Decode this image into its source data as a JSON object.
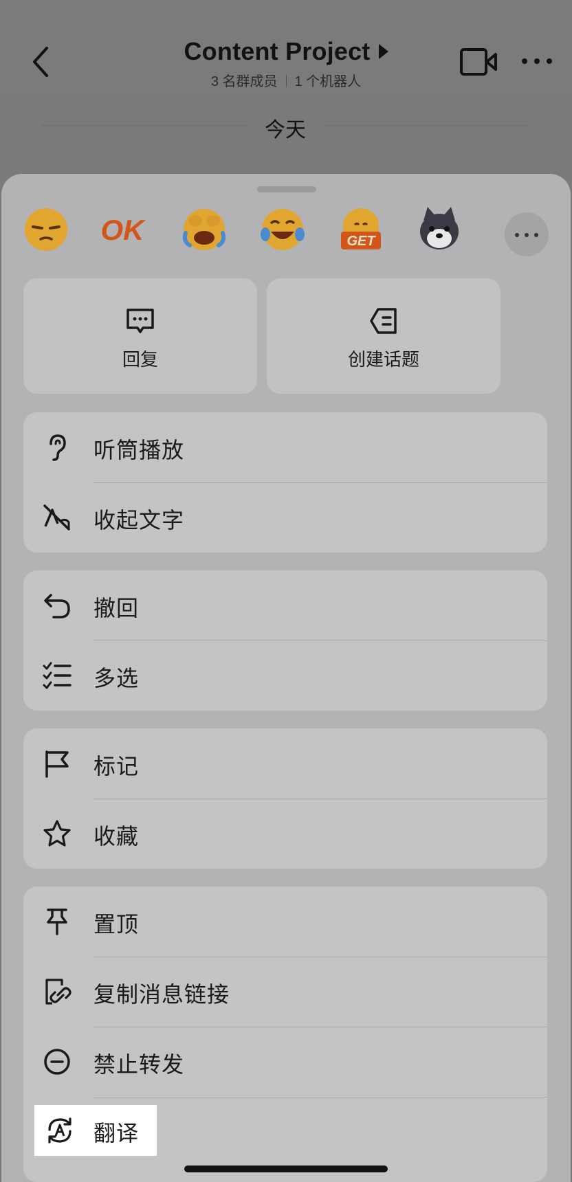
{
  "header": {
    "title": "Content Project",
    "members": "3 名群成员",
    "bots": "1 个机器人"
  },
  "date_divider": "今天",
  "sheet": {
    "emojis": [
      "unamused-face-emoji",
      "ok-sticker",
      "crying-laughing-emoji",
      "tears-of-joy-emoji",
      "get-sticker",
      "dog-sticker"
    ],
    "actions": [
      {
        "label": "回复",
        "icon": "reply-bubble-icon"
      },
      {
        "label": "创建话题",
        "icon": "create-topic-icon"
      }
    ],
    "groups": [
      [
        {
          "label": "听筒播放",
          "icon": "ear-icon"
        },
        {
          "label": "收起文字",
          "icon": "hide-text-icon"
        }
      ],
      [
        {
          "label": "撤回",
          "icon": "undo-icon"
        },
        {
          "label": "多选",
          "icon": "multi-select-icon"
        }
      ],
      [
        {
          "label": "标记",
          "icon": "flag-icon"
        },
        {
          "label": "收藏",
          "icon": "star-icon"
        }
      ],
      [
        {
          "label": "置顶",
          "icon": "pin-icon"
        },
        {
          "label": "复制消息链接",
          "icon": "copy-link-icon"
        },
        {
          "label": "禁止转发",
          "icon": "forbid-forward-icon"
        },
        {
          "label": "翻译",
          "icon": "translate-icon"
        }
      ]
    ]
  },
  "colors": {
    "overlay": "#7a7a7a",
    "sheet": "#b3b3b5",
    "card": "#c4c4c5",
    "text": "#1a1a1a",
    "highlight": "#ffffff"
  }
}
